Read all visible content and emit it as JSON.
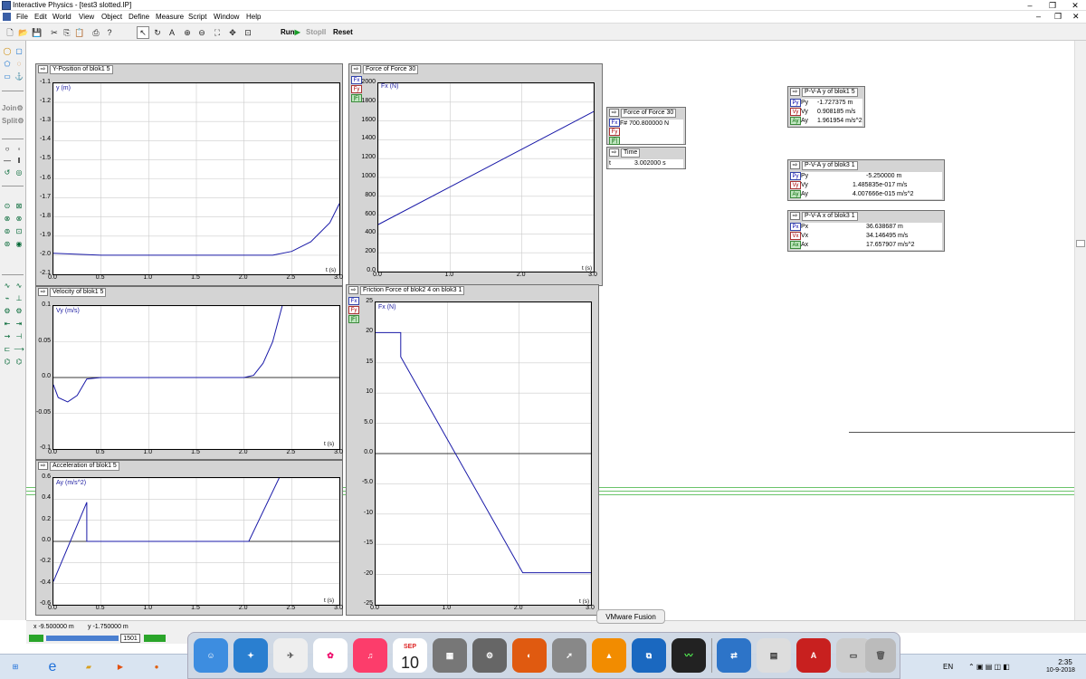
{
  "window": {
    "title": "Interactive Physics - [test3 slotted.IP]",
    "controls": [
      "–",
      "❐",
      "✕"
    ]
  },
  "menu": [
    "File",
    "Edit",
    "World",
    "View",
    "Object",
    "Define",
    "Measure",
    "Script",
    "Window",
    "Help"
  ],
  "toolbar": {
    "run": "Run",
    "stop": "StopII",
    "reset": "Reset"
  },
  "lefttools": {
    "join": "Join",
    "split": "Split"
  },
  "graphs": {
    "ypos": {
      "title": "Y-Position of blok1 5",
      "yname": "y (m)",
      "xname": "t (s)",
      "yticks": [
        "-1.1",
        "-1.2",
        "-1.3",
        "-1.4",
        "-1.5",
        "-1.6",
        "-1.7",
        "-1.8",
        "-1.9",
        "-2.0",
        "-2.1"
      ],
      "xticks": [
        "0.0",
        "0.5",
        "1.0",
        "1.5",
        "2.0",
        "2.5",
        "3.0"
      ]
    },
    "force30": {
      "title": "Force of Force 30",
      "yname": "Fx (N)",
      "xname": "t (s)",
      "yticks": [
        "2000",
        "1800",
        "1600",
        "1400",
        "1200",
        "1000",
        "800",
        "600",
        "400",
        "200",
        "0.0"
      ],
      "xticks": [
        "0.0",
        "1.0",
        "2.0",
        "3.0"
      ]
    },
    "vel": {
      "title": "Velocity of blok1 5",
      "yname": "Vy (m/s)",
      "xname": "t (s)",
      "yticks": [
        "0.1",
        "0.05",
        "0.0",
        "-0.05",
        "-0.1"
      ],
      "xticks": [
        "0.0",
        "0.5",
        "1.0",
        "1.5",
        "2.0",
        "2.5",
        "3.0"
      ]
    },
    "acc": {
      "title": "Acceleration of blok1 5",
      "yname": "Ay (m/s^2)",
      "xname": "t (s)",
      "yticks": [
        "0.6",
        "0.4",
        "0.2",
        "0.0",
        "-0.2",
        "-0.4",
        "-0.6"
      ],
      "xticks": [
        "0.0",
        "0.5",
        "1.0",
        "1.5",
        "2.0",
        "2.5",
        "3.0"
      ]
    },
    "friction": {
      "title": "Friction Force of blok2 4 on blok3 1",
      "yname": "Fx (N)",
      "xname": "t (s)",
      "yticks": [
        "25",
        "20",
        "15",
        "10",
        "5.0",
        "0.0",
        "-5.0",
        "-10",
        "-15",
        "-20",
        "-25"
      ],
      "xticks": [
        "0.0",
        "1.0",
        "2.0",
        "3.0"
      ]
    }
  },
  "chart_data": [
    {
      "type": "line",
      "title": "Y-Position of blok1 5",
      "ylabel": "y (m)",
      "xlabel": "t (s)",
      "xlim": [
        0,
        3.0
      ],
      "ylim": [
        -2.1,
        -1.1
      ],
      "series": [
        {
          "x": [
            0,
            0.5,
            1.0,
            1.5,
            2.0,
            2.3,
            2.5,
            2.7,
            2.9,
            3.0
          ],
          "y": [
            -1.99,
            -2.0,
            -2.0,
            -2.0,
            -2.0,
            -2.0,
            -1.98,
            -1.93,
            -1.83,
            -1.73
          ]
        }
      ]
    },
    {
      "type": "line",
      "title": "Force of Force 30",
      "ylabel": "Fx (N)",
      "xlabel": "t (s)",
      "xlim": [
        0,
        3.0
      ],
      "ylim": [
        0,
        2000
      ],
      "series": [
        {
          "x": [
            0,
            3.0
          ],
          "y": [
            500,
            1700
          ]
        }
      ]
    },
    {
      "type": "line",
      "title": "Velocity of blok1 5",
      "ylabel": "Vy (m/s)",
      "xlabel": "t (s)",
      "xlim": [
        0,
        3.0
      ],
      "ylim": [
        -0.1,
        0.1
      ],
      "series": [
        {
          "x": [
            0,
            0.05,
            0.15,
            0.25,
            0.35,
            0.5,
            1.0,
            1.5,
            2.0,
            2.1,
            2.2,
            2.3,
            2.4
          ],
          "y": [
            -0.01,
            -0.028,
            -0.034,
            -0.025,
            -0.002,
            0.0,
            0.0,
            0.0,
            0.0,
            0.003,
            0.02,
            0.05,
            0.1
          ]
        }
      ]
    },
    {
      "type": "line",
      "title": "Acceleration of blok1 5",
      "ylabel": "Ay (m/s^2)",
      "xlabel": "t (s)",
      "xlim": [
        0,
        3.0
      ],
      "ylim": [
        -0.6,
        0.6
      ],
      "series": [
        {
          "x": [
            0,
            0.35,
            0.35,
            1.0,
            2.05,
            2.4
          ],
          "y": [
            -0.38,
            0.37,
            0.0,
            0.0,
            0.0,
            0.66
          ]
        }
      ]
    },
    {
      "type": "line",
      "title": "Friction Force of blok2 4 on blok3 1",
      "ylabel": "Fx (N)",
      "xlabel": "t (s)",
      "xlim": [
        0,
        3.0
      ],
      "ylim": [
        -25,
        25
      ],
      "series": [
        {
          "x": [
            0,
            0.35,
            0.35,
            2.05,
            3.0
          ],
          "y": [
            20,
            20,
            16,
            -19.7,
            -19.7
          ]
        }
      ]
    }
  ],
  "panels": {
    "force30": {
      "title": "Force of Force 30",
      "row": "F# 700.800000 N"
    },
    "time": {
      "title": "Time",
      "label": "t",
      "value": "3.002000 s"
    },
    "pva_y_blok15": {
      "title": "P-V-A y of blok1 5",
      "rows": [
        {
          "k": "Py",
          "v": "-1.727375 m"
        },
        {
          "k": "Vy",
          "v": "0.908185 m/s"
        },
        {
          "k": "Ay",
          "v": "1.961954 m/s^2"
        }
      ]
    },
    "pva_y_blok31": {
      "title": "P-V-A y of blok3 1",
      "rows": [
        {
          "k": "Py",
          "v": "-5.250000 m"
        },
        {
          "k": "Vy",
          "v": "1.485835e-017 m/s"
        },
        {
          "k": "Ay",
          "v": "4.007666e-015 m/s^2"
        }
      ]
    },
    "pva_x_blok31": {
      "title": "P-V-A x of blok3 1",
      "rows": [
        {
          "k": "Px",
          "v": "36.638687 m"
        },
        {
          "k": "Vx",
          "v": "34.146495 m/s"
        },
        {
          "k": "Ax",
          "v": "17.657907 m/s^2"
        }
      ]
    }
  },
  "status": {
    "x": "x -9.500000  m",
    "y": "y -1.750000  m",
    "frame": "1501"
  },
  "dock": {
    "tooltip": "VMware Fusion",
    "calendar_month": "SEP",
    "calendar_day": "10"
  },
  "taskbar": {
    "lang": "EN",
    "time": "2:35",
    "date": "10-9-2018"
  }
}
